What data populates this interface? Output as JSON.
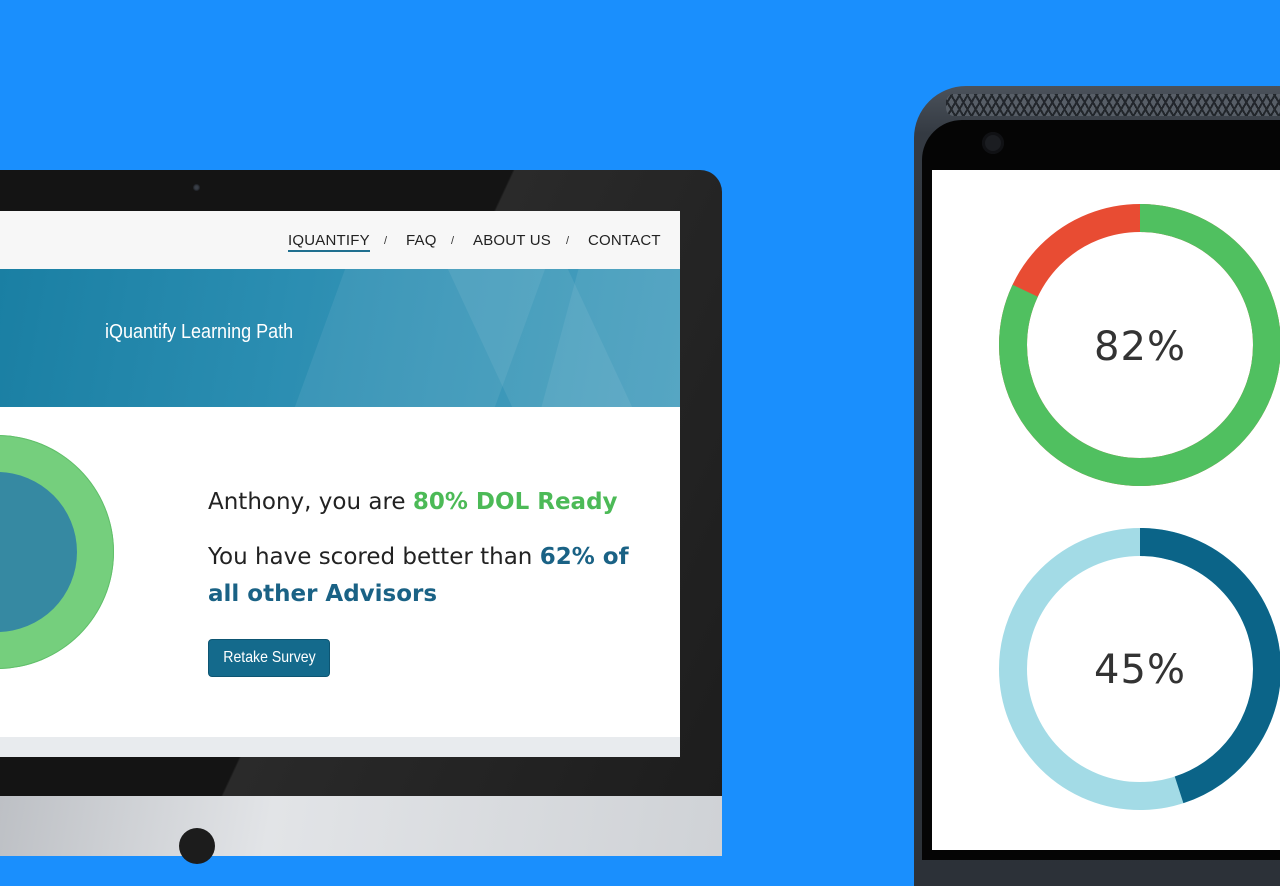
{
  "nav": {
    "items": [
      {
        "label": "IQUANTIFY",
        "active": true
      },
      {
        "label": "FAQ",
        "active": false
      },
      {
        "label": "ABOUT US",
        "active": false
      },
      {
        "label": "CONTACT",
        "active": false
      }
    ],
    "separator": "/"
  },
  "banner": {
    "title": "iQuantify Learning Path"
  },
  "results": {
    "line1_prefix": "Anthony, you are ",
    "line1_highlight": "80% DOL Ready",
    "line2_prefix": "You have scored better than ",
    "line2_highlight_a": "62% of",
    "line2_highlight_b": "all other Advisors",
    "retake_label": "Retake Survey"
  },
  "phone": {
    "rings": [
      {
        "label": "82%",
        "value": 0.82,
        "primary_color": "#50c060",
        "secondary_color": "#e84c33"
      },
      {
        "label": "45%",
        "value": 0.45,
        "primary_color": "#0b6488",
        "secondary_color": "#a3dbe6"
      }
    ]
  },
  "colors": {
    "background": "#1a8ffd",
    "accent_green": "#4cba57",
    "accent_blue": "#1a6285",
    "button": "#146a8c"
  }
}
